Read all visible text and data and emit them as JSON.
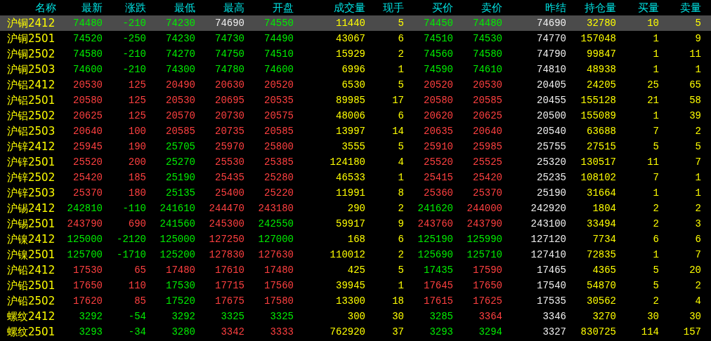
{
  "columns": [
    {
      "label": "名称",
      "kind": "name"
    },
    {
      "label": "最新",
      "kind": "price"
    },
    {
      "label": "涨跌",
      "kind": "price"
    },
    {
      "label": "最低",
      "kind": "price"
    },
    {
      "label": "最高",
      "kind": "price"
    },
    {
      "label": "开盘",
      "kind": "price"
    },
    {
      "label": "成交量",
      "kind": "qty"
    },
    {
      "label": "现手",
      "kind": "qty"
    },
    {
      "label": "买价",
      "kind": "price"
    },
    {
      "label": "卖价",
      "kind": "price"
    },
    {
      "label": "昨结",
      "kind": "settle"
    },
    {
      "label": "持仓量",
      "kind": "qty"
    },
    {
      "label": "买量",
      "kind": "qty"
    },
    {
      "label": "卖量",
      "kind": "qty"
    }
  ],
  "rows": [
    {
      "selected": true,
      "cells": [
        {
          "text": "沪铜2412"
        },
        {
          "text": "74480",
          "color": "#00ee00"
        },
        {
          "text": "-210",
          "color": "#00ee00"
        },
        {
          "text": "74230",
          "color": "#00ee00"
        },
        {
          "text": "74690",
          "color": "#f0f0f0"
        },
        {
          "text": "74550",
          "color": "#00ee00"
        },
        {
          "text": "11440"
        },
        {
          "text": "5"
        },
        {
          "text": "74450",
          "color": "#00ee00"
        },
        {
          "text": "74480",
          "color": "#00ee00"
        },
        {
          "text": "74690"
        },
        {
          "text": "32780"
        },
        {
          "text": "10"
        },
        {
          "text": "5"
        }
      ]
    },
    {
      "selected": false,
      "cells": [
        {
          "text": "沪铜2501"
        },
        {
          "text": "74520",
          "color": "#00ee00"
        },
        {
          "text": "-250",
          "color": "#00ee00"
        },
        {
          "text": "74230",
          "color": "#00ee00"
        },
        {
          "text": "74730",
          "color": "#00ee00"
        },
        {
          "text": "74490",
          "color": "#00ee00"
        },
        {
          "text": "43067"
        },
        {
          "text": "6"
        },
        {
          "text": "74510",
          "color": "#00ee00"
        },
        {
          "text": "74530",
          "color": "#00ee00"
        },
        {
          "text": "74770"
        },
        {
          "text": "157048"
        },
        {
          "text": "1"
        },
        {
          "text": "9"
        }
      ]
    },
    {
      "selected": false,
      "cells": [
        {
          "text": "沪铜2502"
        },
        {
          "text": "74580",
          "color": "#00ee00"
        },
        {
          "text": "-210",
          "color": "#00ee00"
        },
        {
          "text": "74270",
          "color": "#00ee00"
        },
        {
          "text": "74750",
          "color": "#00ee00"
        },
        {
          "text": "74510",
          "color": "#00ee00"
        },
        {
          "text": "15929"
        },
        {
          "text": "2"
        },
        {
          "text": "74560",
          "color": "#00ee00"
        },
        {
          "text": "74580",
          "color": "#00ee00"
        },
        {
          "text": "74790"
        },
        {
          "text": "99847"
        },
        {
          "text": "1"
        },
        {
          "text": "11"
        }
      ]
    },
    {
      "selected": false,
      "cells": [
        {
          "text": "沪铜2503"
        },
        {
          "text": "74600",
          "color": "#00ee00"
        },
        {
          "text": "-210",
          "color": "#00ee00"
        },
        {
          "text": "74300",
          "color": "#00ee00"
        },
        {
          "text": "74780",
          "color": "#00ee00"
        },
        {
          "text": "74600",
          "color": "#00ee00"
        },
        {
          "text": "6996"
        },
        {
          "text": "1"
        },
        {
          "text": "74590",
          "color": "#00ee00"
        },
        {
          "text": "74610",
          "color": "#00ee00"
        },
        {
          "text": "74810"
        },
        {
          "text": "48938"
        },
        {
          "text": "1"
        },
        {
          "text": "1"
        }
      ]
    },
    {
      "selected": false,
      "cells": [
        {
          "text": "沪铝2412"
        },
        {
          "text": "20530",
          "color": "#ff4040"
        },
        {
          "text": "125",
          "color": "#ff4040"
        },
        {
          "text": "20490",
          "color": "#ff4040"
        },
        {
          "text": "20630",
          "color": "#ff4040"
        },
        {
          "text": "20520",
          "color": "#ff4040"
        },
        {
          "text": "6530"
        },
        {
          "text": "5"
        },
        {
          "text": "20520",
          "color": "#ff4040"
        },
        {
          "text": "20530",
          "color": "#ff4040"
        },
        {
          "text": "20405"
        },
        {
          "text": "24205"
        },
        {
          "text": "25"
        },
        {
          "text": "65"
        }
      ]
    },
    {
      "selected": false,
      "cells": [
        {
          "text": "沪铝2501"
        },
        {
          "text": "20580",
          "color": "#ff4040"
        },
        {
          "text": "125",
          "color": "#ff4040"
        },
        {
          "text": "20530",
          "color": "#ff4040"
        },
        {
          "text": "20695",
          "color": "#ff4040"
        },
        {
          "text": "20535",
          "color": "#ff4040"
        },
        {
          "text": "89985"
        },
        {
          "text": "17"
        },
        {
          "text": "20580",
          "color": "#ff4040"
        },
        {
          "text": "20585",
          "color": "#ff4040"
        },
        {
          "text": "20455"
        },
        {
          "text": "155128"
        },
        {
          "text": "21"
        },
        {
          "text": "58"
        }
      ]
    },
    {
      "selected": false,
      "cells": [
        {
          "text": "沪铝2502"
        },
        {
          "text": "20625",
          "color": "#ff4040"
        },
        {
          "text": "125",
          "color": "#ff4040"
        },
        {
          "text": "20570",
          "color": "#ff4040"
        },
        {
          "text": "20730",
          "color": "#ff4040"
        },
        {
          "text": "20575",
          "color": "#ff4040"
        },
        {
          "text": "48006"
        },
        {
          "text": "6"
        },
        {
          "text": "20620",
          "color": "#ff4040"
        },
        {
          "text": "20625",
          "color": "#ff4040"
        },
        {
          "text": "20500"
        },
        {
          "text": "155089"
        },
        {
          "text": "1"
        },
        {
          "text": "39"
        }
      ]
    },
    {
      "selected": false,
      "cells": [
        {
          "text": "沪铝2503"
        },
        {
          "text": "20640",
          "color": "#ff4040"
        },
        {
          "text": "100",
          "color": "#ff4040"
        },
        {
          "text": "20585",
          "color": "#ff4040"
        },
        {
          "text": "20735",
          "color": "#ff4040"
        },
        {
          "text": "20585",
          "color": "#ff4040"
        },
        {
          "text": "13997"
        },
        {
          "text": "14"
        },
        {
          "text": "20635",
          "color": "#ff4040"
        },
        {
          "text": "20640",
          "color": "#ff4040"
        },
        {
          "text": "20540"
        },
        {
          "text": "63688"
        },
        {
          "text": "7"
        },
        {
          "text": "2"
        }
      ]
    },
    {
      "selected": false,
      "cells": [
        {
          "text": "沪锌2412"
        },
        {
          "text": "25945",
          "color": "#ff4040"
        },
        {
          "text": "190",
          "color": "#ff4040"
        },
        {
          "text": "25705",
          "color": "#00ee00"
        },
        {
          "text": "25970",
          "color": "#ff4040"
        },
        {
          "text": "25800",
          "color": "#ff4040"
        },
        {
          "text": "3555"
        },
        {
          "text": "5"
        },
        {
          "text": "25910",
          "color": "#ff4040"
        },
        {
          "text": "25985",
          "color": "#ff4040"
        },
        {
          "text": "25755"
        },
        {
          "text": "27515"
        },
        {
          "text": "5"
        },
        {
          "text": "5"
        }
      ]
    },
    {
      "selected": false,
      "cells": [
        {
          "text": "沪锌2501"
        },
        {
          "text": "25520",
          "color": "#ff4040"
        },
        {
          "text": "200",
          "color": "#ff4040"
        },
        {
          "text": "25270",
          "color": "#00ee00"
        },
        {
          "text": "25530",
          "color": "#ff4040"
        },
        {
          "text": "25385",
          "color": "#ff4040"
        },
        {
          "text": "124180"
        },
        {
          "text": "4"
        },
        {
          "text": "25520",
          "color": "#ff4040"
        },
        {
          "text": "25525",
          "color": "#ff4040"
        },
        {
          "text": "25320"
        },
        {
          "text": "130517"
        },
        {
          "text": "11"
        },
        {
          "text": "7"
        }
      ]
    },
    {
      "selected": false,
      "cells": [
        {
          "text": "沪锌2502"
        },
        {
          "text": "25420",
          "color": "#ff4040"
        },
        {
          "text": "185",
          "color": "#ff4040"
        },
        {
          "text": "25190",
          "color": "#00ee00"
        },
        {
          "text": "25435",
          "color": "#ff4040"
        },
        {
          "text": "25280",
          "color": "#ff4040"
        },
        {
          "text": "46533"
        },
        {
          "text": "1"
        },
        {
          "text": "25415",
          "color": "#ff4040"
        },
        {
          "text": "25420",
          "color": "#ff4040"
        },
        {
          "text": "25235"
        },
        {
          "text": "108102"
        },
        {
          "text": "7"
        },
        {
          "text": "1"
        }
      ]
    },
    {
      "selected": false,
      "cells": [
        {
          "text": "沪锌2503"
        },
        {
          "text": "25370",
          "color": "#ff4040"
        },
        {
          "text": "180",
          "color": "#ff4040"
        },
        {
          "text": "25135",
          "color": "#00ee00"
        },
        {
          "text": "25400",
          "color": "#ff4040"
        },
        {
          "text": "25220",
          "color": "#ff4040"
        },
        {
          "text": "11991"
        },
        {
          "text": "8"
        },
        {
          "text": "25360",
          "color": "#ff4040"
        },
        {
          "text": "25370",
          "color": "#ff4040"
        },
        {
          "text": "25190"
        },
        {
          "text": "31664"
        },
        {
          "text": "1"
        },
        {
          "text": "1"
        }
      ]
    },
    {
      "selected": false,
      "cells": [
        {
          "text": "沪锡2412"
        },
        {
          "text": "242810",
          "color": "#00ee00"
        },
        {
          "text": "-110",
          "color": "#00ee00"
        },
        {
          "text": "241610",
          "color": "#00ee00"
        },
        {
          "text": "244470",
          "color": "#ff4040"
        },
        {
          "text": "243180",
          "color": "#ff4040"
        },
        {
          "text": "290"
        },
        {
          "text": "2"
        },
        {
          "text": "241620",
          "color": "#00ee00"
        },
        {
          "text": "244000",
          "color": "#ff4040"
        },
        {
          "text": "242920"
        },
        {
          "text": "1804"
        },
        {
          "text": "2"
        },
        {
          "text": "2"
        }
      ]
    },
    {
      "selected": false,
      "cells": [
        {
          "text": "沪锡2501"
        },
        {
          "text": "243790",
          "color": "#ff4040"
        },
        {
          "text": "690",
          "color": "#ff4040"
        },
        {
          "text": "241560",
          "color": "#00ee00"
        },
        {
          "text": "245300",
          "color": "#ff4040"
        },
        {
          "text": "242550",
          "color": "#00ee00"
        },
        {
          "text": "59917"
        },
        {
          "text": "9"
        },
        {
          "text": "243760",
          "color": "#ff4040"
        },
        {
          "text": "243790",
          "color": "#ff4040"
        },
        {
          "text": "243100"
        },
        {
          "text": "33494"
        },
        {
          "text": "2"
        },
        {
          "text": "3"
        }
      ]
    },
    {
      "selected": false,
      "cells": [
        {
          "text": "沪镍2412"
        },
        {
          "text": "125000",
          "color": "#00ee00"
        },
        {
          "text": "-2120",
          "color": "#00ee00"
        },
        {
          "text": "125000",
          "color": "#00ee00"
        },
        {
          "text": "127250",
          "color": "#ff4040"
        },
        {
          "text": "127000",
          "color": "#00ee00"
        },
        {
          "text": "168"
        },
        {
          "text": "6"
        },
        {
          "text": "125190",
          "color": "#00ee00"
        },
        {
          "text": "125990",
          "color": "#00ee00"
        },
        {
          "text": "127120"
        },
        {
          "text": "7734"
        },
        {
          "text": "6"
        },
        {
          "text": "6"
        }
      ]
    },
    {
      "selected": false,
      "cells": [
        {
          "text": "沪镍2501"
        },
        {
          "text": "125700",
          "color": "#00ee00"
        },
        {
          "text": "-1710",
          "color": "#00ee00"
        },
        {
          "text": "125200",
          "color": "#00ee00"
        },
        {
          "text": "127830",
          "color": "#ff4040"
        },
        {
          "text": "127630",
          "color": "#ff4040"
        },
        {
          "text": "110012"
        },
        {
          "text": "2"
        },
        {
          "text": "125690",
          "color": "#00ee00"
        },
        {
          "text": "125710",
          "color": "#00ee00"
        },
        {
          "text": "127410"
        },
        {
          "text": "72835"
        },
        {
          "text": "1"
        },
        {
          "text": "7"
        }
      ]
    },
    {
      "selected": false,
      "cells": [
        {
          "text": "沪铅2412"
        },
        {
          "text": "17530",
          "color": "#ff4040"
        },
        {
          "text": "65",
          "color": "#ff4040"
        },
        {
          "text": "17480",
          "color": "#ff4040"
        },
        {
          "text": "17610",
          "color": "#ff4040"
        },
        {
          "text": "17480",
          "color": "#ff4040"
        },
        {
          "text": "425"
        },
        {
          "text": "5"
        },
        {
          "text": "17435",
          "color": "#00ee00"
        },
        {
          "text": "17590",
          "color": "#ff4040"
        },
        {
          "text": "17465"
        },
        {
          "text": "4365"
        },
        {
          "text": "5"
        },
        {
          "text": "20"
        }
      ]
    },
    {
      "selected": false,
      "cells": [
        {
          "text": "沪铅2501"
        },
        {
          "text": "17650",
          "color": "#ff4040"
        },
        {
          "text": "110",
          "color": "#ff4040"
        },
        {
          "text": "17530",
          "color": "#00ee00"
        },
        {
          "text": "17715",
          "color": "#ff4040"
        },
        {
          "text": "17560",
          "color": "#ff4040"
        },
        {
          "text": "39945"
        },
        {
          "text": "1"
        },
        {
          "text": "17645",
          "color": "#ff4040"
        },
        {
          "text": "17650",
          "color": "#ff4040"
        },
        {
          "text": "17540"
        },
        {
          "text": "54870"
        },
        {
          "text": "5"
        },
        {
          "text": "2"
        }
      ]
    },
    {
      "selected": false,
      "cells": [
        {
          "text": "沪铅2502"
        },
        {
          "text": "17620",
          "color": "#ff4040"
        },
        {
          "text": "85",
          "color": "#ff4040"
        },
        {
          "text": "17520",
          "color": "#00ee00"
        },
        {
          "text": "17675",
          "color": "#ff4040"
        },
        {
          "text": "17580",
          "color": "#ff4040"
        },
        {
          "text": "13300"
        },
        {
          "text": "18"
        },
        {
          "text": "17615",
          "color": "#ff4040"
        },
        {
          "text": "17625",
          "color": "#ff4040"
        },
        {
          "text": "17535"
        },
        {
          "text": "30562"
        },
        {
          "text": "2"
        },
        {
          "text": "4"
        }
      ]
    },
    {
      "selected": false,
      "cells": [
        {
          "text": "螺纹2412"
        },
        {
          "text": "3292",
          "color": "#00ee00"
        },
        {
          "text": "-54",
          "color": "#00ee00"
        },
        {
          "text": "3292",
          "color": "#00ee00"
        },
        {
          "text": "3325",
          "color": "#00ee00"
        },
        {
          "text": "3325",
          "color": "#00ee00"
        },
        {
          "text": "300"
        },
        {
          "text": "30"
        },
        {
          "text": "3285",
          "color": "#00ee00"
        },
        {
          "text": "3364",
          "color": "#ff4040"
        },
        {
          "text": "3346"
        },
        {
          "text": "3270"
        },
        {
          "text": "30"
        },
        {
          "text": "30"
        }
      ]
    },
    {
      "selected": false,
      "cells": [
        {
          "text": "螺纹2501"
        },
        {
          "text": "3293",
          "color": "#00ee00"
        },
        {
          "text": "-34",
          "color": "#00ee00"
        },
        {
          "text": "3280",
          "color": "#00ee00"
        },
        {
          "text": "3342",
          "color": "#ff4040"
        },
        {
          "text": "3333",
          "color": "#ff4040"
        },
        {
          "text": "762920"
        },
        {
          "text": "37"
        },
        {
          "text": "3293",
          "color": "#00ee00"
        },
        {
          "text": "3294",
          "color": "#00ee00"
        },
        {
          "text": "3327"
        },
        {
          "text": "830725"
        },
        {
          "text": "114"
        },
        {
          "text": "157"
        }
      ]
    }
  ]
}
